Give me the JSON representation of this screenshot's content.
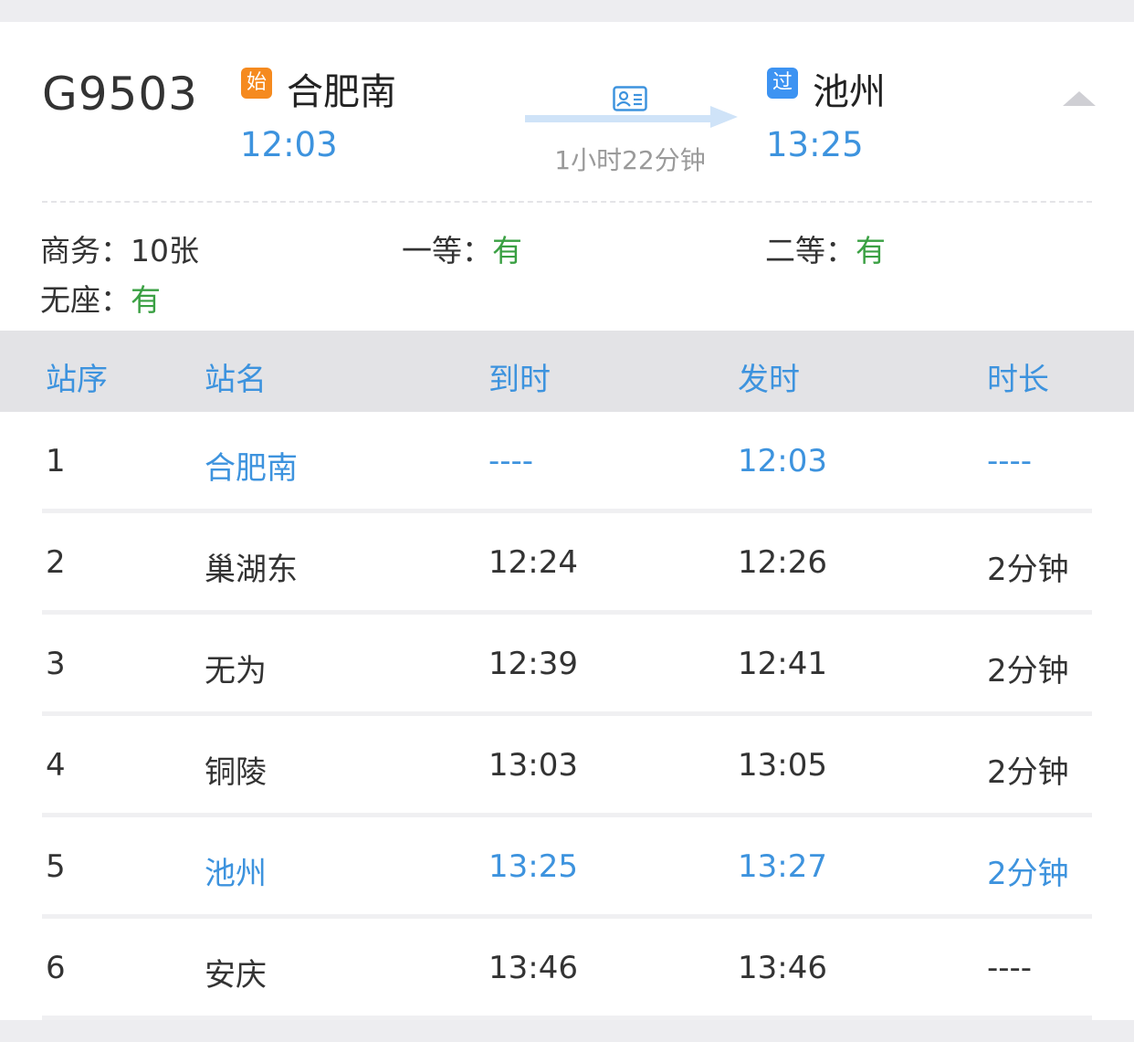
{
  "train": {
    "number": "G9503",
    "from": {
      "badge": "始",
      "name": "合肥南",
      "time": "12:03"
    },
    "to": {
      "badge": "过",
      "name": "池州",
      "time": "13:25"
    },
    "duration": "1小时22分钟",
    "icons": {
      "id_card": "id-card-icon",
      "collapse": "collapse-up-icon"
    },
    "colors": {
      "start_badge": "#f58a1f",
      "pass_badge": "#3d93f2",
      "accent": "#3d93de",
      "available": "#3aa043"
    }
  },
  "seats": [
    {
      "label": "商务：",
      "value": "10张",
      "available_color": false
    },
    {
      "label": "一等：",
      "value": "有",
      "available_color": true
    },
    {
      "label": "二等：",
      "value": "有",
      "available_color": true
    },
    {
      "label": "无座：",
      "value": "有",
      "available_color": true
    }
  ],
  "table": {
    "headers": [
      "站序",
      "站名",
      "到时",
      "发时",
      "时长"
    ],
    "rows": [
      {
        "seq": "1",
        "station": "合肥南",
        "arrive": "----",
        "depart": "12:03",
        "stay": "----",
        "highlight": "all"
      },
      {
        "seq": "2",
        "station": "巢湖东",
        "arrive": "12:24",
        "depart": "12:26",
        "stay": "2分钟",
        "highlight": "none"
      },
      {
        "seq": "3",
        "station": "无为",
        "arrive": "12:39",
        "depart": "12:41",
        "stay": "2分钟",
        "highlight": "none"
      },
      {
        "seq": "4",
        "station": "铜陵",
        "arrive": "13:03",
        "depart": "13:05",
        "stay": "2分钟",
        "highlight": "none"
      },
      {
        "seq": "5",
        "station": "池州",
        "arrive": "13:25",
        "depart": "13:27",
        "stay": "2分钟",
        "highlight": "all"
      },
      {
        "seq": "6",
        "station": "安庆",
        "arrive": "13:46",
        "depart": "13:46",
        "stay": "----",
        "highlight": "none"
      }
    ]
  }
}
